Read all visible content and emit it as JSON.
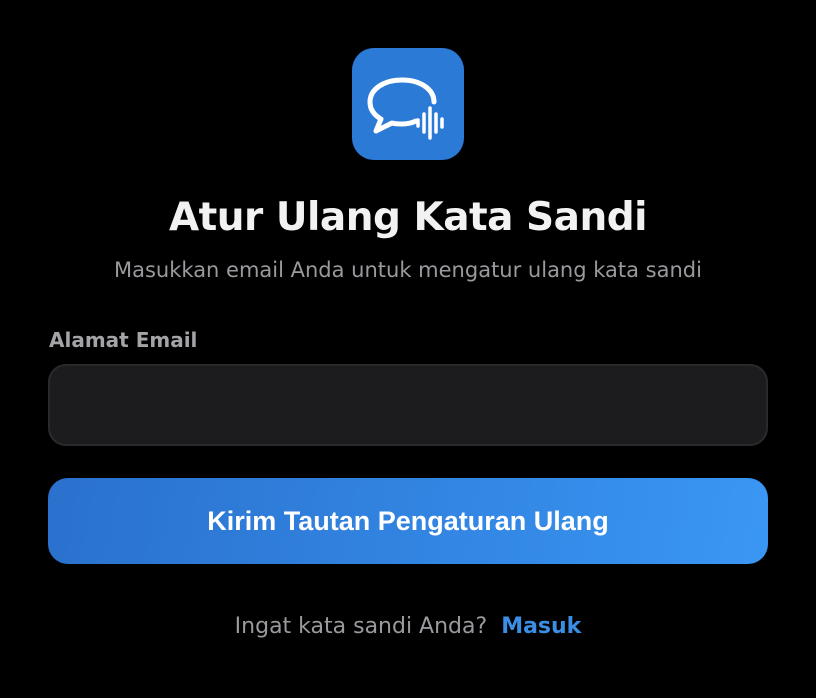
{
  "app_icon": {
    "name": "chat-bubble-voice-icon",
    "background": "#2b7ad6"
  },
  "header": {
    "title": "Atur Ulang Kata Sandi",
    "subtitle": "Masukkan email Anda untuk mengatur ulang kata sandi"
  },
  "form": {
    "email_label": "Alamat Email",
    "email_value": "",
    "email_placeholder": "",
    "submit_label": "Kirim Tautan Pengaturan Ulang"
  },
  "footer": {
    "prompt": "Ingat kata sandi Anda?",
    "login_link": "Masuk"
  },
  "colors": {
    "background": "#000000",
    "accent": "#3b8ee6",
    "input_background": "#1c1c1e"
  }
}
